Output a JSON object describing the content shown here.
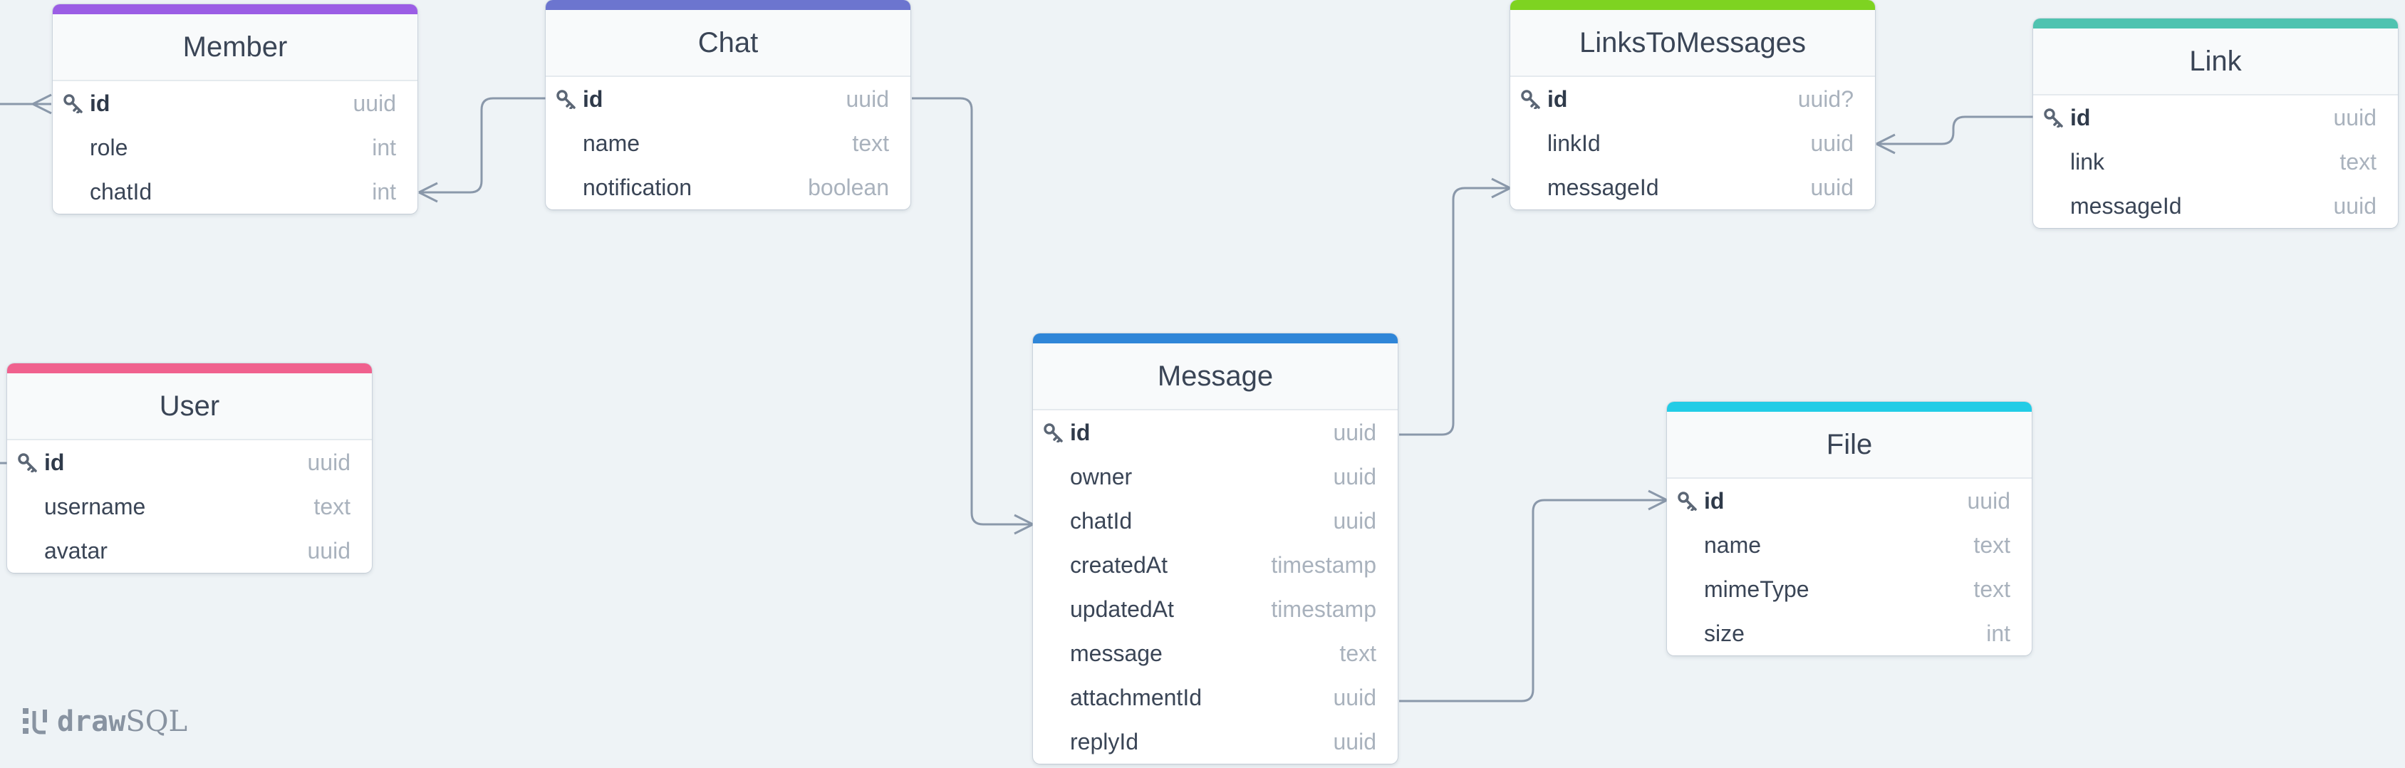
{
  "app": {
    "brand_prefix": "draw",
    "brand_suffix": "SQL"
  },
  "colors": {
    "member": "#9b5de5",
    "chat": "#6c75cf",
    "links_to_messages": "#7ed321",
    "link": "#4fc3b0",
    "user": "#f0618e",
    "message": "#2f86d8",
    "file": "#22cce6",
    "connector": "#8a98aa"
  },
  "tables": {
    "member": {
      "name": "Member",
      "fields": [
        {
          "name": "id",
          "type": "uuid",
          "pk": true
        },
        {
          "name": "role",
          "type": "int"
        },
        {
          "name": "chatId",
          "type": "int"
        }
      ]
    },
    "chat": {
      "name": "Chat",
      "fields": [
        {
          "name": "id",
          "type": "uuid",
          "pk": true
        },
        {
          "name": "name",
          "type": "text"
        },
        {
          "name": "notification",
          "type": "boolean"
        }
      ]
    },
    "links_to_messages": {
      "name": "LinksToMessages",
      "fields": [
        {
          "name": "id",
          "type": "uuid?",
          "pk": true
        },
        {
          "name": "linkId",
          "type": "uuid"
        },
        {
          "name": "messageId",
          "type": "uuid"
        }
      ]
    },
    "link": {
      "name": "Link",
      "fields": [
        {
          "name": "id",
          "type": "uuid",
          "pk": true
        },
        {
          "name": "link",
          "type": "text"
        },
        {
          "name": "messageId",
          "type": "uuid"
        }
      ]
    },
    "user": {
      "name": "User",
      "fields": [
        {
          "name": "id",
          "type": "uuid",
          "pk": true
        },
        {
          "name": "username",
          "type": "text"
        },
        {
          "name": "avatar",
          "type": "uuid"
        }
      ]
    },
    "message": {
      "name": "Message",
      "fields": [
        {
          "name": "id",
          "type": "uuid",
          "pk": true
        },
        {
          "name": "owner",
          "type": "uuid"
        },
        {
          "name": "chatId",
          "type": "uuid"
        },
        {
          "name": "createdAt",
          "type": "timestamp"
        },
        {
          "name": "updatedAt",
          "type": "timestamp"
        },
        {
          "name": "message",
          "type": "text"
        },
        {
          "name": "attachmentId",
          "type": "uuid"
        },
        {
          "name": "replyId",
          "type": "uuid"
        }
      ]
    },
    "file": {
      "name": "File",
      "fields": [
        {
          "name": "id",
          "type": "uuid",
          "pk": true
        },
        {
          "name": "name",
          "type": "text"
        },
        {
          "name": "mimeType",
          "type": "text"
        },
        {
          "name": "size",
          "type": "int"
        }
      ]
    }
  }
}
